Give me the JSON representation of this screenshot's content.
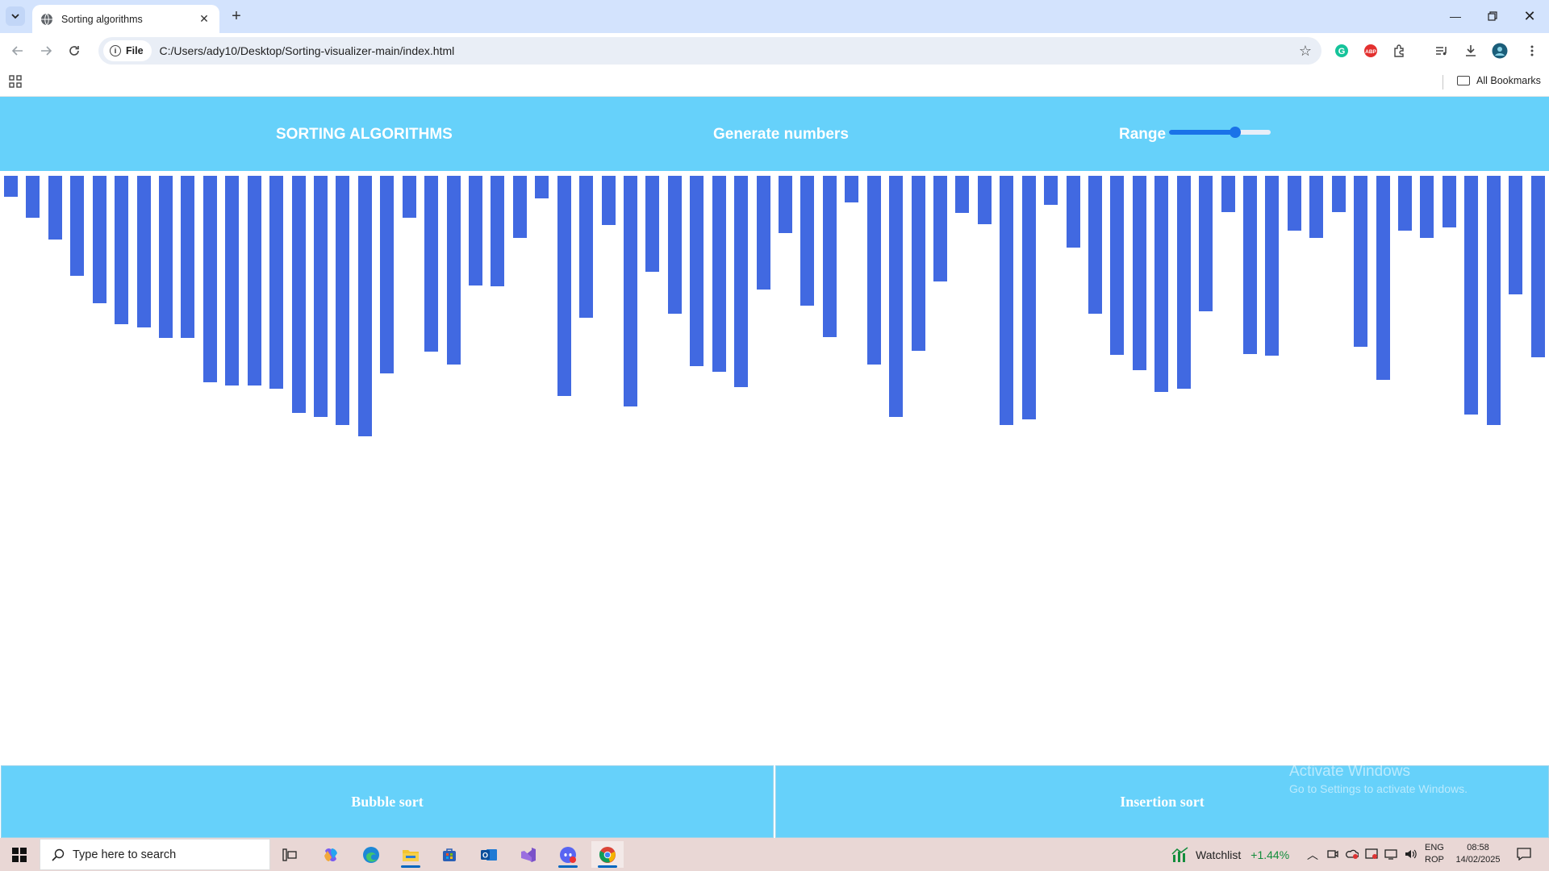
{
  "browser": {
    "tab_title": "Sorting algorithms",
    "site_chip": "File",
    "url": "C:/Users/ady10/Desktop/Sorting-visualizer-main/index.html",
    "bookmarks_label": "All Bookmarks"
  },
  "page": {
    "title": "SORTING ALGORITHMS",
    "generate_label": "Generate numbers",
    "range_label": "Range",
    "range_value_fraction": 0.67,
    "bar_color": "#4169e1",
    "header_color": "#66d1fa",
    "bar_values": [
      26,
      52,
      79,
      124,
      158,
      184,
      188,
      201,
      201,
      256,
      260,
      260,
      264,
      294,
      299,
      309,
      323,
      245,
      52,
      218,
      234,
      136,
      137,
      77,
      28,
      273,
      176,
      61,
      286,
      119,
      171,
      236,
      243,
      262,
      141,
      71,
      161,
      200,
      33,
      234,
      299,
      217,
      131,
      46,
      60,
      309,
      302,
      36,
      89,
      171,
      222,
      241,
      268,
      264,
      168,
      45,
      221,
      223,
      68,
      77,
      45,
      212,
      253,
      68,
      77,
      64,
      296,
      309,
      147,
      225
    ],
    "buttons": {
      "bubble": "Bubble sort",
      "insertion": "Insertion sort"
    },
    "watermark_line1": "Activate Windows",
    "watermark_line2": "Go to Settings to activate Windows."
  },
  "taskbar": {
    "search_placeholder": "Type here to search",
    "watchlist_label": "Watchlist",
    "watchlist_change": "+1.44%",
    "lang_line1": "ENG",
    "lang_line2": "ROP",
    "time": "08:58",
    "date": "14/02/2025"
  }
}
